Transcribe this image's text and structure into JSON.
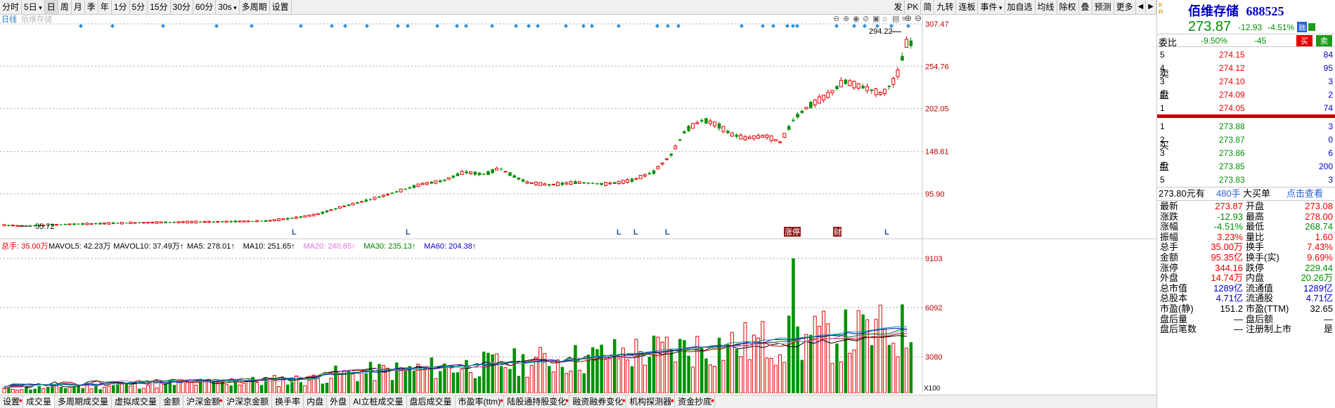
{
  "toolbar": {
    "left": [
      {
        "label": "分时",
        "drop": false,
        "sel": false
      },
      {
        "label": "5日",
        "drop": true,
        "sel": false
      },
      {
        "label": "日",
        "drop": false,
        "sel": true
      },
      {
        "label": "周",
        "drop": false,
        "sel": false
      },
      {
        "label": "月",
        "drop": false,
        "sel": false
      },
      {
        "label": "季",
        "drop": false,
        "sel": false
      },
      {
        "label": "年",
        "drop": false,
        "sel": false
      },
      {
        "label": "1分",
        "drop": false,
        "sel": false
      },
      {
        "label": "5分",
        "drop": false,
        "sel": false
      },
      {
        "label": "15分",
        "drop": false,
        "sel": false
      },
      {
        "label": "30分",
        "drop": false,
        "sel": false
      },
      {
        "label": "60分",
        "drop": false,
        "sel": false
      },
      {
        "label": "30s",
        "drop": true,
        "sel": false
      },
      {
        "label": "多周期",
        "drop": false,
        "sel": false
      },
      {
        "label": "设置",
        "drop": false,
        "sel": false
      }
    ],
    "right": [
      "发",
      "PK",
      "简",
      "九转",
      "连板",
      "事件",
      "加自选",
      "均线",
      "除权",
      "叠",
      "预测",
      "更多"
    ],
    "right_drop": [
      false,
      false,
      false,
      false,
      false,
      true,
      false,
      false,
      false,
      false,
      false,
      false
    ],
    "nav_icons": [
      "play-back-icon",
      "play-forward-icon"
    ]
  },
  "chart": {
    "period_label": "日线",
    "stock_watermark": "佰维存储",
    "price_ticks": [
      "307.47",
      "254.76",
      "202.05",
      "148.61",
      "95.90"
    ],
    "high_mark": "294.22",
    "low_mark": "55.72",
    "event_labels": [
      "涨停",
      "财"
    ],
    "l_markers": [
      "L",
      "L",
      "L",
      "L",
      "L",
      "L"
    ],
    "tool_icons": [
      "zoom-out-icon",
      "zoom-in-icon",
      "eye-icon",
      "eye-slash-icon",
      "lock-icon",
      "home-icon",
      "image-icon",
      "list-icon",
      "add-circle-icon",
      "minus-circle-icon"
    ]
  },
  "volume": {
    "legend": [
      {
        "text": "总手: 35.00万",
        "color": "#e00000"
      },
      {
        "text": "MAVOL5: 42.23万",
        "color": "#000000"
      },
      {
        "text": "MAVOL10: 37.49万↑",
        "color": "#000000"
      },
      {
        "text": "MA5: 278.01↑",
        "color": "#000000"
      },
      {
        "text": "MA10: 251.65↑",
        "color": "#000000"
      },
      {
        "text": "MA20: 240.65↑",
        "color": "#e070e0"
      },
      {
        "text": "MA30: 235.13↑",
        "color": "#008000"
      },
      {
        "text": "MA60: 204.38↑",
        "color": "#0000c8"
      }
    ],
    "ticks": [
      "9103",
      "6092",
      "3080"
    ],
    "unit": "X100"
  },
  "bottom_tabs": [
    {
      "label": "设置",
      "sel": false,
      "mark": true
    },
    {
      "label": "成交量",
      "sel": true,
      "mark": false
    },
    {
      "label": "多周期成交量",
      "sel": false,
      "mark": false
    },
    {
      "label": "虚拟成交量",
      "sel": false,
      "mark": false
    },
    {
      "label": "金额",
      "sel": false,
      "mark": false
    },
    {
      "label": "沪深金额",
      "sel": false,
      "mark": true
    },
    {
      "label": "沪深京金额",
      "sel": false,
      "mark": false
    },
    {
      "label": "换手率",
      "sel": false,
      "mark": false
    },
    {
      "label": "内盘",
      "sel": false,
      "mark": false
    },
    {
      "label": "外盘",
      "sel": false,
      "mark": false
    },
    {
      "label": "AI立桩成交量",
      "sel": false,
      "mark": false
    },
    {
      "label": "盘后成交量",
      "sel": false,
      "mark": false
    },
    {
      "label": "市盈率(ttm)",
      "sel": false,
      "mark": true
    },
    {
      "label": "陆股通持股变化",
      "sel": false,
      "mark": true
    },
    {
      "label": "融资融券变化",
      "sel": false,
      "mark": true
    },
    {
      "label": "机构探测器",
      "sel": false,
      "mark": true
    },
    {
      "label": "资金抄底",
      "sel": false,
      "mark": true
    }
  ],
  "side": {
    "kr": [
      "K",
      "R"
    ],
    "name": "佰维存储",
    "code": "688525",
    "price": "273.87",
    "change": "-12.93",
    "change_pct": "-4.51%",
    "badges": [
      "融",
      "■"
    ],
    "weibi_label": "委比",
    "weibi_pct": "-9.50%",
    "weibi_diff": "-45",
    "buy_btn": "买",
    "sell_btn": "卖",
    "sell_label": [
      "卖",
      "盘"
    ],
    "buy_label": [
      "买",
      "盘"
    ],
    "asks": [
      {
        "lvl": "5",
        "price": "274.15",
        "vol": "84"
      },
      {
        "lvl": "4",
        "price": "274.12",
        "vol": "95"
      },
      {
        "lvl": "3",
        "price": "274.10",
        "vol": "3"
      },
      {
        "lvl": "2",
        "price": "274.09",
        "vol": "2"
      },
      {
        "lvl": "1",
        "price": "274.05",
        "vol": "74"
      }
    ],
    "bids": [
      {
        "lvl": "1",
        "price": "273.88",
        "vol": "3"
      },
      {
        "lvl": "2",
        "price": "273.87",
        "vol": "0"
      },
      {
        "lvl": "3",
        "price": "273.86",
        "vol": "6"
      },
      {
        "lvl": "4",
        "price": "273.85",
        "vol": "200"
      },
      {
        "lvl": "5",
        "price": "273.83",
        "vol": "3"
      }
    ],
    "big_order": {
      "price": "273.80元有",
      "qty": "480手",
      "label": "大买单",
      "link": "点击查看"
    },
    "quotes": [
      {
        "l1": "最新",
        "v1": "273.87",
        "c1": "red",
        "l2": "开盘",
        "v2": "273.08",
        "c2": "red"
      },
      {
        "l1": "涨跌",
        "v1": "-12.93",
        "c1": "grn",
        "l2": "最高",
        "v2": "278.00",
        "c2": "red"
      },
      {
        "l1": "涨幅",
        "v1": "-4.51%",
        "c1": "grn",
        "l2": "最低",
        "v2": "268.74",
        "c2": "grn"
      },
      {
        "l1": "振幅",
        "v1": "3.23%",
        "c1": "red",
        "l2": "量比",
        "v2": "1.60",
        "c2": "red"
      },
      {
        "l1": "总手",
        "v1": "35.00万",
        "c1": "red",
        "l2": "换手",
        "v2": "7.43%",
        "c2": "red"
      },
      {
        "l1": "金额",
        "v1": "95.35亿",
        "c1": "red",
        "l2": "换手(实)",
        "v2": "9.69%",
        "c2": "red"
      },
      {
        "l1": "涨停",
        "v1": "344.16",
        "c1": "red",
        "l2": "跌停",
        "v2": "229.44",
        "c2": "grn"
      },
      {
        "l1": "外盘",
        "v1": "14.74万",
        "c1": "red",
        "l2": "内盘",
        "v2": "20.26万",
        "c2": "grn"
      },
      {
        "l1": "总市值",
        "v1": "1289亿",
        "c1": "blue",
        "l2": "流通值",
        "v2": "1289亿",
        "c2": "blue"
      },
      {
        "l1": "总股本",
        "v1": "4.71亿",
        "c1": "blue",
        "l2": "流通股",
        "v2": "4.71亿",
        "c2": "blue"
      },
      {
        "l1": "市盈(静)",
        "v1": "151.2",
        "c1": "blk",
        "l2": "市盈(TTM)",
        "v2": "32.65",
        "c2": "blk"
      },
      {
        "l1": "盘后量",
        "v1": "—",
        "c1": "blk",
        "l2": "盘后额",
        "v2": "—",
        "c2": "blk"
      },
      {
        "l1": "盘后笔数",
        "v1": "—",
        "c1": "blk",
        "l2": "注册制上市",
        "v2": "是",
        "c2": "blk"
      }
    ]
  }
}
